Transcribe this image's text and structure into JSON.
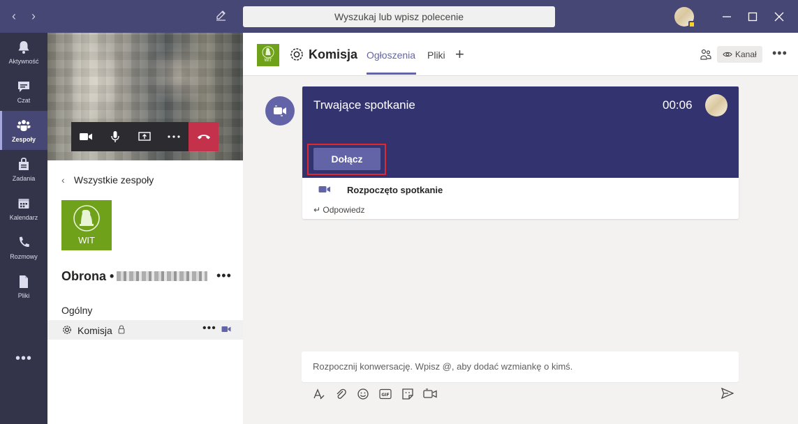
{
  "titlebar": {
    "search_placeholder": "Wyszukaj lub wpisz polecenie"
  },
  "rail": {
    "items": [
      {
        "label": "Aktywność",
        "icon": "bell-icon"
      },
      {
        "label": "Czat",
        "icon": "chat-icon"
      },
      {
        "label": "Zespoły",
        "icon": "teams-icon",
        "active": true
      },
      {
        "label": "Zadania",
        "icon": "assignments-icon"
      },
      {
        "label": "Kalendarz",
        "icon": "calendar-icon"
      },
      {
        "label": "Rozmowy",
        "icon": "phone-icon"
      },
      {
        "label": "Pliki",
        "icon": "files-icon"
      }
    ],
    "more": "•••"
  },
  "panel": {
    "back_label": "Wszystkie zespoły",
    "team_logo_text": "WIT",
    "team_name": "Obrona •",
    "more": "•••",
    "section_label": "Ogólny",
    "channel_name": "Komisja",
    "channel_more": "•••"
  },
  "header": {
    "logo_text": "WIT",
    "channel_title": "Komisja",
    "tabs": [
      "Ogłoszenia",
      "Pliki"
    ],
    "kanal_label": "Kanał",
    "more": "•••"
  },
  "card": {
    "title": "Trwające spotkanie",
    "time": "00:06",
    "join_label": "Dołącz",
    "event_text": "Rozpoczęto spotkanie",
    "reply_label": "Odpowiedz"
  },
  "compose": {
    "placeholder": "Rozpocznij konwersację. Wpisz @, aby dodać wzmiankę o kimś."
  },
  "colors": {
    "brand": "#464775",
    "rail": "#33344a",
    "accent": "#6264a7",
    "meeting_header": "#33346f",
    "hangup": "#c4314b",
    "highlight": "#e0282f",
    "team_logo": "#6fa11a"
  }
}
